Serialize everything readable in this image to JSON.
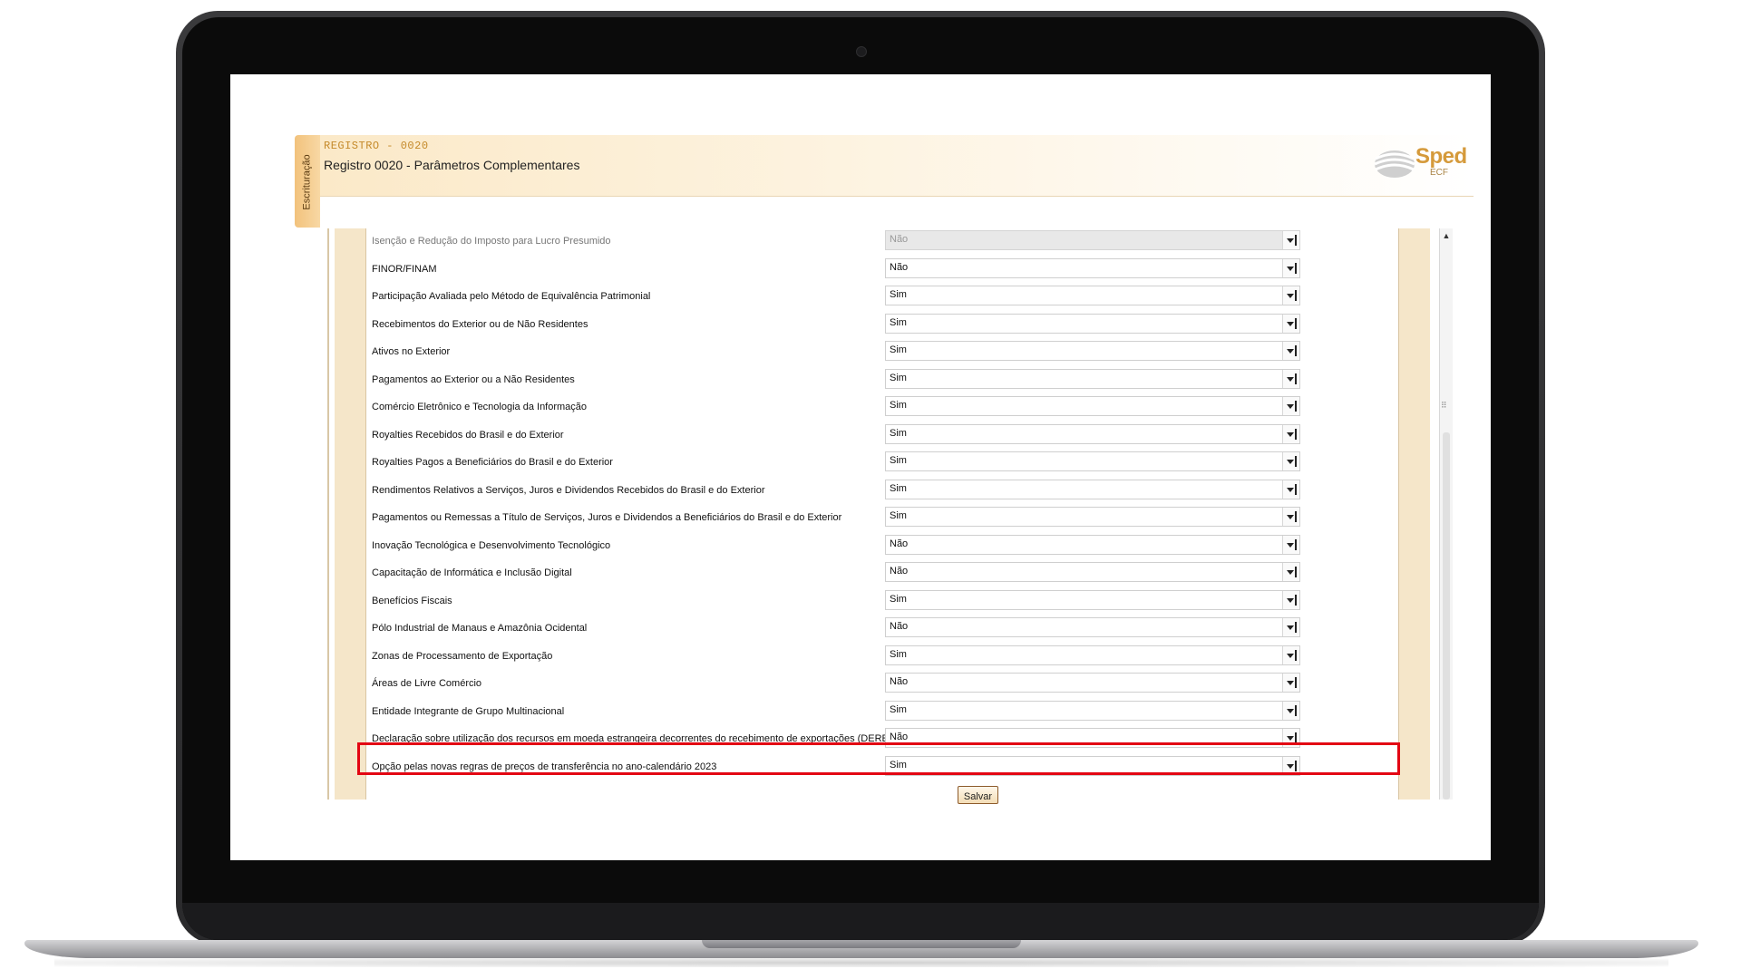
{
  "sidebar": {
    "tab_label": "Escrituração"
  },
  "header": {
    "register_code": "REGISTRO - 0020",
    "title": "Registro 0020 - Parâmetros Complementares",
    "logo_text": "Sped",
    "logo_sub": "ECF"
  },
  "form": {
    "rows": [
      {
        "label": "Isenção e Redução do Imposto para Lucro Presumido",
        "value": "Não",
        "disabled": true
      },
      {
        "label": "FINOR/FINAM",
        "value": "Não"
      },
      {
        "label": "Participação Avaliada pelo Método de Equivalência Patrimonial",
        "value": "Sim"
      },
      {
        "label": "Recebimentos do Exterior ou de Não Residentes",
        "value": "Sim"
      },
      {
        "label": "Ativos no Exterior",
        "value": "Sim"
      },
      {
        "label": "Pagamentos ao Exterior ou a Não Residentes",
        "value": "Sim"
      },
      {
        "label": "Comércio Eletrônico e Tecnologia da Informação",
        "value": "Sim"
      },
      {
        "label": "Royalties Recebidos do Brasil e do Exterior",
        "value": "Sim"
      },
      {
        "label": "Royalties Pagos a Beneficiários do Brasil e do Exterior",
        "value": "Sim"
      },
      {
        "label": "Rendimentos Relativos a Serviços, Juros e Dividendos Recebidos do Brasil e do Exterior",
        "value": "Sim"
      },
      {
        "label": "Pagamentos ou Remessas a Título de Serviços, Juros e Dividendos a Beneficiários do Brasil e do Exterior",
        "value": "Sim"
      },
      {
        "label": "Inovação Tecnológica e Desenvolvimento Tecnológico",
        "value": "Não"
      },
      {
        "label": "Capacitação de Informática e Inclusão Digital",
        "value": "Não"
      },
      {
        "label": "Benefícios Fiscais",
        "value": "Sim"
      },
      {
        "label": "Pólo Industrial de Manaus e Amazônia Ocidental",
        "value": "Não"
      },
      {
        "label": "Zonas de Processamento de Exportação",
        "value": "Sim"
      },
      {
        "label": "Áreas de Livre Comércio",
        "value": "Não"
      },
      {
        "label": "Entidade Integrante de Grupo Multinacional",
        "value": "Sim"
      },
      {
        "label": "Declaração sobre utilização dos recursos em moeda estrangeira decorrentes do recebimento de exportações (DEREX)",
        "value": "Não"
      },
      {
        "label": "Opção pelas novas regras de preços de transferência no ano-calendário 2023",
        "value": "Sim"
      }
    ],
    "save_label": "Salvar"
  },
  "colors": {
    "highlight": "#e30613",
    "accent": "#d59a3b",
    "panel": "#f5e6c9"
  },
  "icons": {
    "dropdown": "chevron-down-icon",
    "scroll_up": "arrow-up-icon"
  }
}
